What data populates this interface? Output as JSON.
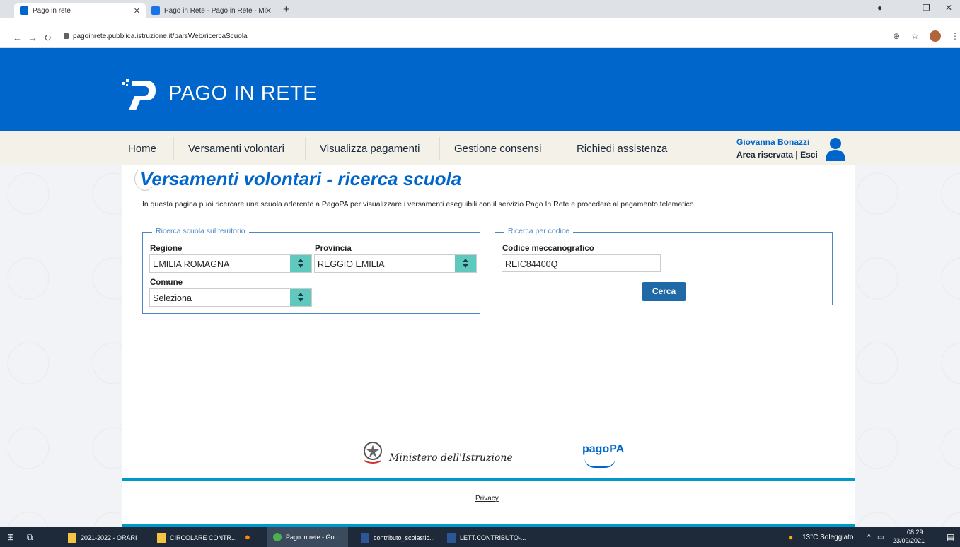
{
  "browser": {
    "tabs": [
      {
        "title": "Pago in rete",
        "active": true
      },
      {
        "title": "Pago in Rete - Pago in Rete - Mi",
        "active": false
      }
    ],
    "url": "pagoinrete.pubblica.istruzione.it/parsWeb/ricercaScuola"
  },
  "header": {
    "brand": "PAGO IN RETE"
  },
  "menu": {
    "items": [
      "Home",
      "Versamenti volontari",
      "Visualizza pagamenti",
      "Gestione consensi",
      "Richiedi assistenza"
    ]
  },
  "user": {
    "name": "Giovanna Bonazzi",
    "area": "Area riservata",
    "separator": "|",
    "logout": "Esci"
  },
  "page": {
    "title": "Versamenti volontari - ricerca scuola",
    "intro": "In questa pagina puoi ricercare una scuola aderente a PagoPA per visualizzare i versamenti eseguibili con il servizio Pago In Rete e procedere al pagamento telematico."
  },
  "territorio": {
    "legend": "Ricerca scuola sul territorio",
    "regione_label": "Regione",
    "regione_value": "EMILIA ROMAGNA",
    "provincia_label": "Provincia",
    "provincia_value": "REGGIO EMILIA",
    "comune_label": "Comune",
    "comune_value": "Seleziona"
  },
  "codice": {
    "legend": "Ricerca per codice",
    "label": "Codice meccanografico",
    "value": "REIC84400Q",
    "button": "Cerca"
  },
  "footer": {
    "ministero": "Ministero dell'Istruzione",
    "pagopa": "pagoPA",
    "privacy": "Privacy"
  },
  "taskbar": {
    "items": [
      "2021-2022 - ORARI",
      "CIRCOLARE CONTR...",
      "Pago in rete - Goo...",
      "contributo_scolastic...",
      "LETT.CONTRIBUTO-..."
    ],
    "weather": "13°C Soleggiato",
    "time": "08:29",
    "date": "23/09/2021"
  },
  "colors": {
    "primary": "#0066cc",
    "select_accent": "#5fc9bd",
    "button": "#1f6aa6"
  }
}
